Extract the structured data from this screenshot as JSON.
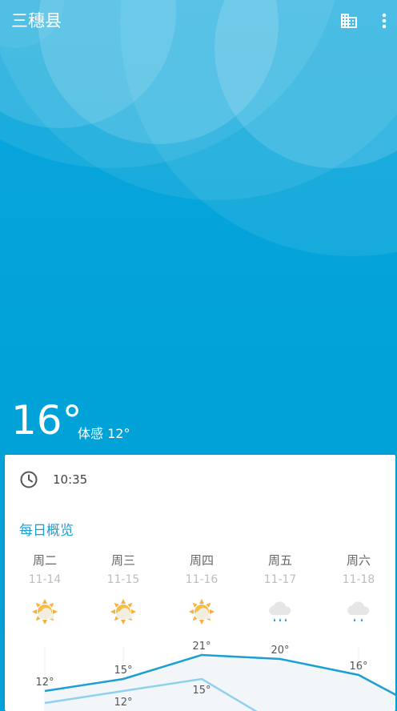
{
  "header": {
    "city": "三穗县",
    "building_icon": "building-icon",
    "more_icon": "more-vert-icon"
  },
  "current": {
    "temperature": "16°",
    "feels_like": "体感 12°"
  },
  "card": {
    "time": "10:35",
    "section_title": "每日概览"
  },
  "days": [
    {
      "weekday": "周二",
      "date": "11-14",
      "icon": "partly-cloudy-sun-icon",
      "high": "12°",
      "low": ""
    },
    {
      "weekday": "周三",
      "date": "11-15",
      "icon": "partly-cloudy-sun-icon",
      "high": "15°",
      "low": "12°"
    },
    {
      "weekday": "周四",
      "date": "11-16",
      "icon": "partly-cloudy-sun-icon",
      "high": "21°",
      "low": "15°"
    },
    {
      "weekday": "周五",
      "date": "11-17",
      "icon": "rain-cloud-icon",
      "high": "20°",
      "low": ""
    },
    {
      "weekday": "周六",
      "date": "11-18",
      "icon": "rain-cloud-icon",
      "high": "16°",
      "low": ""
    }
  ],
  "colors": {
    "sky": "#00a2d8",
    "accent": "#1a9fd6",
    "high_line": "#1b9fd4",
    "low_line": "#8fd0ef"
  }
}
